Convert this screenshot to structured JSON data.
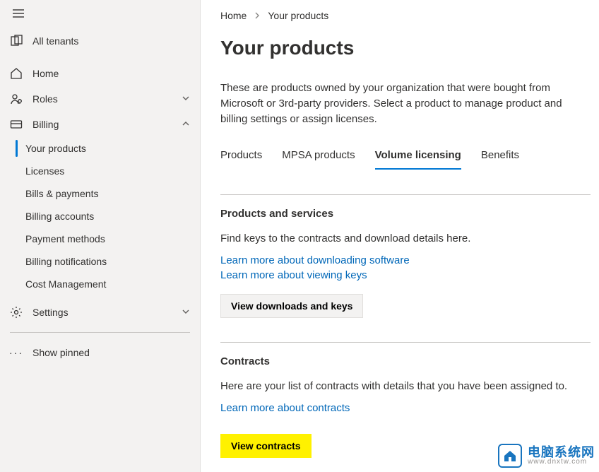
{
  "sidebar": {
    "allTenants": "All tenants",
    "home": "Home",
    "roles": "Roles",
    "billing": "Billing",
    "billingExpanded": true,
    "billingChildren": [
      {
        "label": "Your products",
        "active": true
      },
      {
        "label": "Licenses"
      },
      {
        "label": "Bills & payments"
      },
      {
        "label": "Billing accounts"
      },
      {
        "label": "Payment methods"
      },
      {
        "label": "Billing notifications"
      },
      {
        "label": "Cost Management"
      }
    ],
    "settings": "Settings",
    "showPinned": "Show pinned"
  },
  "breadcrumb": {
    "home": "Home",
    "current": "Your products"
  },
  "page": {
    "title": "Your products",
    "lead": "These are products owned by your organization that were bought from Microsoft or 3rd-party providers. Select a product to manage product and billing settings or assign licenses."
  },
  "tabs": [
    {
      "label": "Products"
    },
    {
      "label": "MPSA products"
    },
    {
      "label": "Volume licensing",
      "active": true
    },
    {
      "label": "Benefits"
    }
  ],
  "sections": {
    "products": {
      "heading": "Products and services",
      "body": "Find keys to the contracts and download details here.",
      "link1": "Learn more about downloading software",
      "link2": "Learn more about viewing keys",
      "button": "View downloads and keys"
    },
    "contracts": {
      "heading": "Contracts",
      "body": "Here are your list of contracts with details that you have been assigned to.",
      "link1": "Learn more about contracts",
      "button": "View contracts"
    }
  },
  "watermark": {
    "cn": "电脑系统网",
    "url": "www.dnxtw.com"
  }
}
